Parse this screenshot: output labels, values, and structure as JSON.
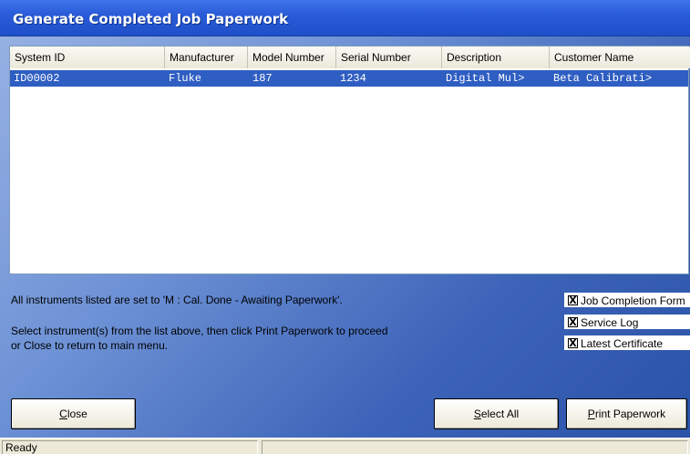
{
  "window": {
    "title": "Generate Completed Job Paperwork"
  },
  "list": {
    "columns": [
      "System ID",
      "Manufacturer",
      "Model Number",
      "Serial Number",
      "Description",
      "Customer Name"
    ],
    "rows": [
      [
        "ID00002",
        "Fluke",
        "187",
        "1234",
        "Digital Mul>",
        "Beta Calibrati>"
      ]
    ]
  },
  "messages": {
    "line1": "All instruments listed are set to 'M : Cal. Done - Awaiting Paperwork'.",
    "line2": "Select instrument(s) from the list above, then click Print Paperwork to proceed",
    "line3": "or Close to return to main menu."
  },
  "options": {
    "job_completion_form": {
      "label": "Job Completion Form",
      "checked": true,
      "mark": "X"
    },
    "service_log": {
      "label": "Service Log",
      "checked": true,
      "mark": "X"
    },
    "latest_certificate": {
      "label": "Latest Certificate",
      "checked": true,
      "mark": "X"
    }
  },
  "buttons": {
    "close": {
      "label": "Close",
      "accel": "C",
      "rest": "lose"
    },
    "select_all": {
      "label": "Select All",
      "accel": "S",
      "rest": "elect All"
    },
    "print": {
      "label": "Print Paperwork",
      "accel": "P",
      "rest": "rint Paperwork"
    }
  },
  "status": {
    "text": "Ready",
    "secondary": ""
  },
  "colors": {
    "selection": "#2f5ec2",
    "titlebar": "#2a5cd9"
  }
}
